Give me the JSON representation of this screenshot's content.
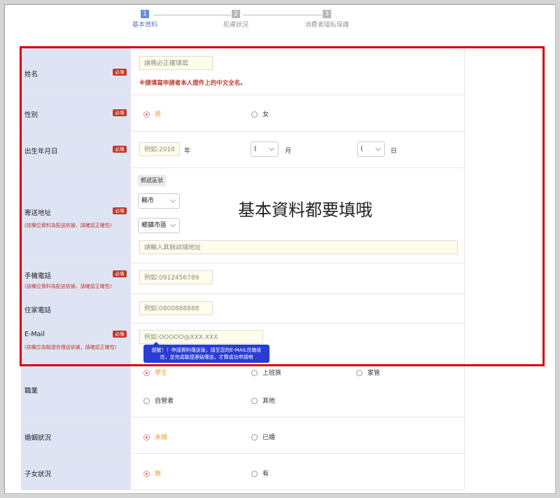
{
  "steps": [
    {
      "num": "1",
      "label": "基本資料"
    },
    {
      "num": "2",
      "label": "肌膚狀況"
    },
    {
      "num": "3",
      "label": "消費者隱私保護"
    }
  ],
  "required_badge": "必填",
  "fields": {
    "name": {
      "label": "姓名",
      "placeholder": "請務必正確填寫",
      "warning": "※請填寫申請者本人證件上的中文全名。"
    },
    "gender": {
      "label": "性別",
      "options": [
        "男",
        "女"
      ],
      "selected": "男"
    },
    "birthday": {
      "label": "出生年月日",
      "year_placeholder": "例如:2018",
      "year_unit": "年",
      "month_value": "(",
      "month_unit": "月",
      "day_value": "(",
      "day_unit": "日"
    },
    "address": {
      "label": "寄送地址",
      "note": "(該欄位資料為配送依據，請確認正確性)",
      "zip_label": "郵遞區號",
      "county": "縣市",
      "district": "鄉鎮市區",
      "detail_placeholder": "請輸入其餘詳細地址"
    },
    "mobile": {
      "label": "手機電話",
      "note": "(該欄位資料為配送依據，請確認正確性)",
      "placeholder": "例如:0912456789"
    },
    "home_phone": {
      "label": "住家電話",
      "placeholder": "例如:0800888888"
    },
    "email": {
      "label": "E-Mail",
      "note": "(該欄位為驗證信傳送依據，請確認正確性)",
      "placeholder": "例如:OOOOO@XXX.XXX",
      "tip": "提醒！！申請資料傳送後，請至您的E-MAIL信箱收信，並完成驗證連結傳送，才算成功申請唷"
    },
    "occupation": {
      "label": "職業",
      "options": [
        "學生",
        "上班族",
        "家管",
        "自營者",
        "其他"
      ],
      "selected": "學生"
    },
    "marital": {
      "label": "婚姻狀況",
      "options": [
        "未婚",
        "已婚"
      ],
      "selected": "未婚"
    },
    "children": {
      "label": "子女狀況",
      "options": [
        "無",
        "有"
      ],
      "selected": "無"
    }
  },
  "overlay_text": "基本資料都要填哦",
  "colors": {
    "highlight_border": "#d40000",
    "label_bg": "#dee4f4",
    "required": "#c0392b",
    "tip_bg": "#2a3bd6"
  }
}
